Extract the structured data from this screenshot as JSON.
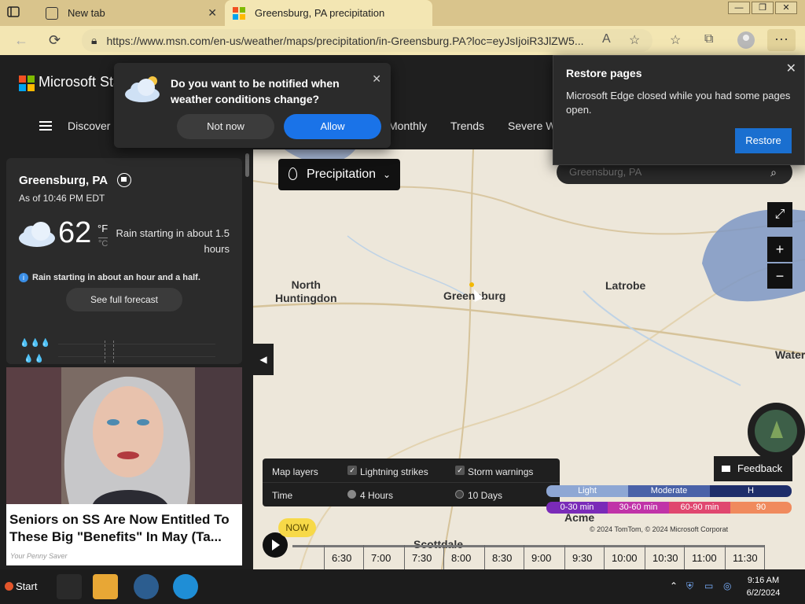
{
  "browser": {
    "tabs": [
      {
        "title": "New tab"
      },
      {
        "title": "Greensburg, PA precipitation"
      }
    ],
    "url": "https://www.msn.com/en-us/weather/maps/precipitation/in-Greensburg.PA?loc=eyJsIjoiR3JlZW5..."
  },
  "header": {
    "brand": "Microsoft Sta",
    "nav": [
      "Discover",
      "Monthly",
      "Trends",
      "Severe W"
    ]
  },
  "notify_popup": {
    "question": "Do you want to be notified when weather conditions change?",
    "not_now": "Not now",
    "allow": "Allow"
  },
  "restore_popup": {
    "title": "Restore pages",
    "message": "Microsoft Edge closed while you had some pages open.",
    "button": "Restore"
  },
  "weather": {
    "location": "Greensburg, PA",
    "as_of": "As of 10:46 PM EDT",
    "temperature": "62",
    "unit_f": "°F",
    "unit_c": "°C",
    "rain_summary": "Rain starting in about 1.5 hours",
    "rain_note": "Rain starting in about an hour and a half.",
    "forecast_button": "See full forecast"
  },
  "ad": {
    "headline": "Seniors on SS Are Now Entitled To These Big \"Benefits\" In May (Ta...",
    "source": "Your Penny Saver"
  },
  "map": {
    "layer_dropdown": "Precipitation",
    "search_placeholder": "Greensburg, PA",
    "places": [
      {
        "label": "North\nHuntingdon"
      },
      {
        "label": "Greensburg"
      },
      {
        "label": "Latrobe"
      },
      {
        "label": "Water"
      },
      {
        "label": "Scottdale"
      },
      {
        "label": "Acme"
      }
    ],
    "layers_label": "Map layers",
    "layer_options": [
      {
        "label": "Lightning strikes",
        "checked": true
      },
      {
        "label": "Storm warnings",
        "checked": true
      }
    ],
    "time_label": "Time",
    "time_options": [
      {
        "label": "4 Hours",
        "selected": true
      },
      {
        "label": "10 Days",
        "selected": false
      }
    ],
    "legend_intensity": [
      "Light",
      "Moderate",
      "H"
    ],
    "legend_time": [
      "0-30 min",
      "30-60 min",
      "60-90 min",
      "90"
    ],
    "feedback": "Feedback",
    "copyright": "© 2024 TomTom, © 2024 Microsoft Corporat",
    "now_label": "NOW",
    "timeline": [
      "6:30",
      "7:00",
      "7:30",
      "8:00",
      "8:30",
      "9:00",
      "9:30",
      "10:00",
      "10:30",
      "11:00",
      "11:30"
    ]
  },
  "taskbar": {
    "start": "Start",
    "time": "9:16 AM",
    "date": "6/2/2024"
  },
  "colors": {
    "accent_blue": "#1a73e8",
    "restore_blue": "#1a6fd0",
    "now_yellow": "#f7d948",
    "rain_blue": "#7d96c4",
    "legend_light": "#8ea7d4",
    "legend_moderate": "#4a62a8",
    "legend_0_30": "#7a2bb8",
    "legend_30_60": "#c033a8",
    "legend_60_90": "#e0476f"
  }
}
